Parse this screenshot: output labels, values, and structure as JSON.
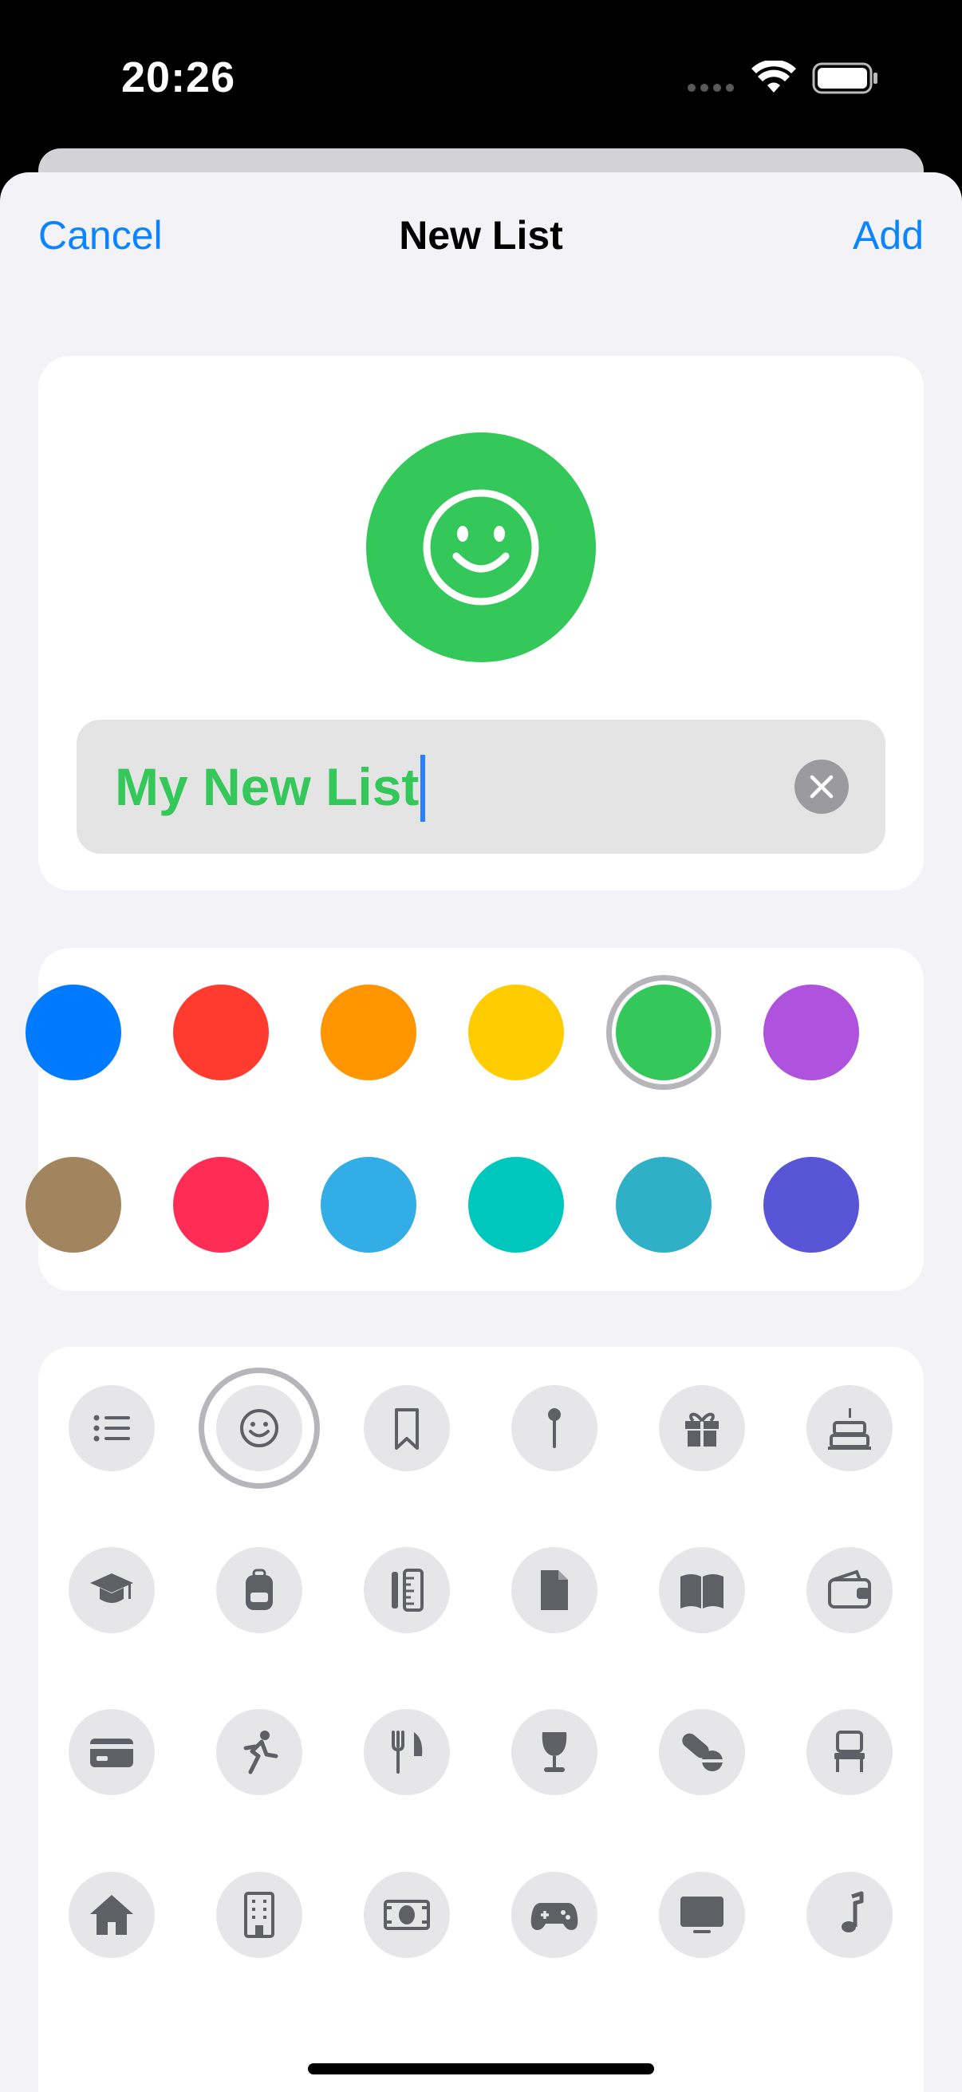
{
  "status_bar": {
    "time": "20:26"
  },
  "nav": {
    "cancel_label": "Cancel",
    "title": "New List",
    "add_label": "Add"
  },
  "list": {
    "name": "My New List",
    "selected_color": "#34c759",
    "selected_icon": "smiley-icon"
  },
  "colors": [
    "#007aff",
    "#ff3b30",
    "#ff9500",
    "#ffcc00",
    "#34c759",
    "#af52de",
    "#a2845e",
    "#ff2d55",
    "#32ade6",
    "#00c7be",
    "#30b0c7",
    "#5856d6"
  ],
  "selected_color_index": 4,
  "icons": [
    "list-icon",
    "smiley-icon",
    "bookmark-icon",
    "pin-icon",
    "gift-icon",
    "birthday-cake-icon",
    "graduation-cap-icon",
    "backpack-icon",
    "pencil-ruler-icon",
    "document-icon",
    "book-icon",
    "wallet-icon",
    "credit-card-icon",
    "running-figure-icon",
    "fork-knife-icon",
    "wine-glass-icon",
    "pills-icon",
    "chair-icon",
    "house-icon",
    "building-icon",
    "banknote-icon",
    "game-controller-icon",
    "display-icon",
    "music-note-icon"
  ],
  "selected_icon_index": 1
}
